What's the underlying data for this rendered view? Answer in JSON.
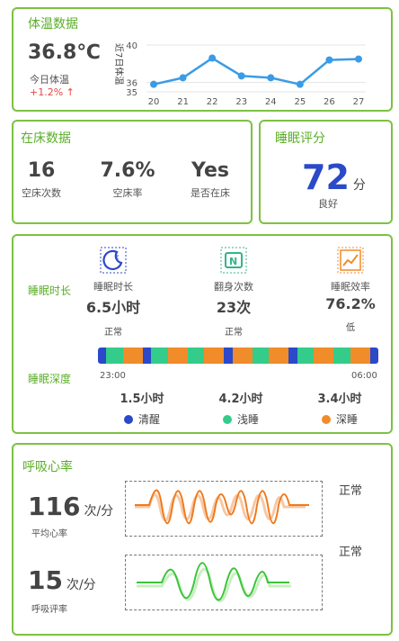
{
  "temperature": {
    "title": "体温数据",
    "value": "36.8℃",
    "label": "今日体温",
    "change": "+1.2% ↑",
    "chart_data": {
      "type": "line",
      "ylabel": "近7日体温",
      "yticks": [
        35,
        36,
        40
      ],
      "ylim": [
        35,
        40
      ],
      "categories": [
        "20",
        "21",
        "22",
        "23",
        "24",
        "25",
        "26",
        "27"
      ],
      "values": [
        35.8,
        36.5,
        38.6,
        36.7,
        36.5,
        35.8,
        38.4,
        38.5
      ],
      "color": "#3a9be6"
    }
  },
  "in_bed": {
    "title": "在床数据",
    "stats": [
      {
        "value": "16",
        "label": "空床次数"
      },
      {
        "value": "7.6%",
        "label": "空床率"
      },
      {
        "value": "Yes",
        "label": "是否在床"
      }
    ]
  },
  "score": {
    "title": "睡眠评分",
    "value": "72",
    "unit": "分",
    "label": "良好",
    "color": "#2b49c8"
  },
  "sleep": {
    "duration_label": "睡眠时长",
    "depth_label": "睡眠深度",
    "metrics": [
      {
        "name": "睡眠时长",
        "value": "6.5小时",
        "status": "正常",
        "icon": "moon-icon"
      },
      {
        "name": "翻身次数",
        "value": "23次",
        "status": "正常",
        "icon": "turnover-icon"
      },
      {
        "name": "睡眠效率",
        "value": "76.2%",
        "status": "低",
        "icon": "trend-chart-icon"
      }
    ],
    "start_time": "23:00",
    "end_time": "06:00",
    "stages": [
      {
        "name": "清醒",
        "hours": "1.5小时",
        "color": "#2b49c8"
      },
      {
        "name": "浅睡",
        "hours": "4.2小时",
        "color": "#34cc8a"
      },
      {
        "name": "深睡",
        "hours": "3.4小时",
        "color": "#f08c2a"
      }
    ],
    "timeline": [
      "awake",
      "light",
      "deep",
      "awake",
      "light",
      "deep",
      "light",
      "deep",
      "awake",
      "deep",
      "light",
      "deep",
      "awake",
      "light",
      "deep",
      "light",
      "deep",
      "awake"
    ]
  },
  "vitals": {
    "title": "呼吸心率",
    "heart_rate": {
      "value": "116",
      "unit": "次/分",
      "label": "平均心率",
      "status": "正常",
      "color": "#f07a1c"
    },
    "breath_rate": {
      "value": "15",
      "unit": "次/分",
      "label": "呼吸评率",
      "status": "正常",
      "color": "#3cc43c"
    }
  }
}
